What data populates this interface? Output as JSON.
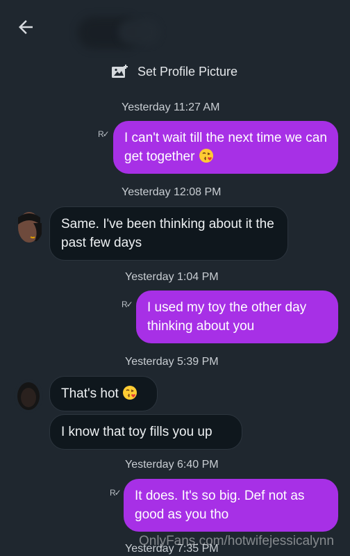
{
  "header": {
    "back_icon": "arrow-left-icon",
    "contact_name": ""
  },
  "system": {
    "set_profile_picture": "Set Profile Picture"
  },
  "messages": [
    {
      "time": "Yesterday 11:27 AM",
      "dir": "out",
      "text": "I can't wait till the next time we can get together",
      "emoji": "face-blowing-kiss"
    },
    {
      "time": "Yesterday 12:08 PM",
      "dir": "in",
      "text": "Same. I've been thinking about it the past few days"
    },
    {
      "time": "Yesterday 1:04 PM",
      "dir": "out",
      "text": "I used my toy the other day thinking about you"
    },
    {
      "time": "Yesterday 5:39 PM",
      "dir": "in",
      "text": "That's hot",
      "emoji": "face-blowing-kiss"
    },
    {
      "time": "",
      "dir": "in",
      "text": "I know that toy fills you up"
    },
    {
      "time": "Yesterday 6:40 PM",
      "dir": "out",
      "text": "It does. It's so big. Def not as good as you tho"
    },
    {
      "time": "Yesterday 7:35 PM",
      "dir": "out",
      "text": ""
    }
  ],
  "read_receipt": "R",
  "watermark": "OnlyFans.com/hotwifejessicalynn",
  "colors": {
    "background": "#1f272f",
    "outgoing_bubble": "#a730e6",
    "incoming_bubble": "#0f171d"
  }
}
